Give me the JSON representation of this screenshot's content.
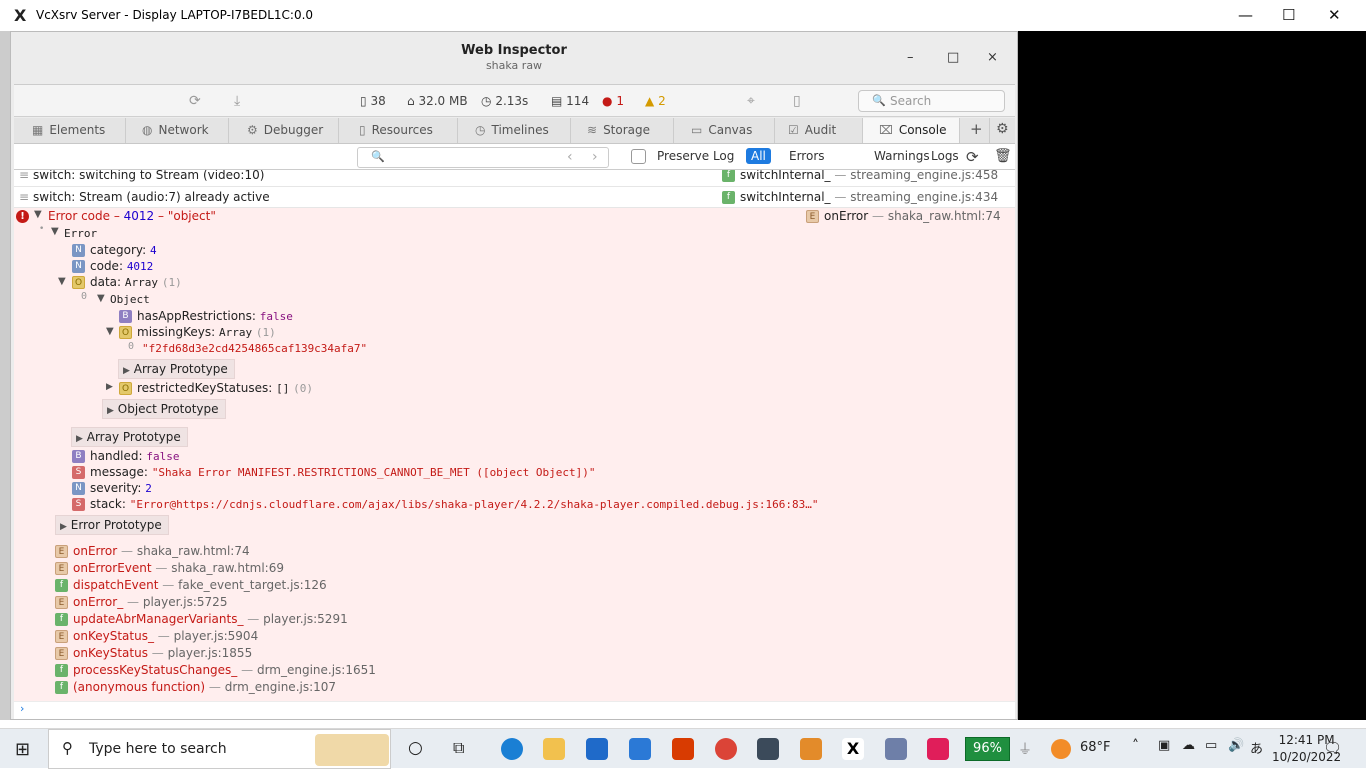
{
  "xwindow": {
    "title": "VcXsrv Server - Display LAPTOP-I7BEDL1C:0.0",
    "minimize": "—",
    "maximize": "☐",
    "close": "✕"
  },
  "inspector": {
    "title": "Web Inspector",
    "subtitle": "shaka raw",
    "minimize": "–",
    "maximize": "□",
    "close": "×",
    "toolbar": {
      "docs": "38",
      "memory": "32.0 MB",
      "time": "2.13s",
      "logs": "114",
      "errors": "1",
      "warnings": "2",
      "search_placeholder": "Search"
    },
    "tabs": [
      "Elements",
      "Network",
      "Debugger",
      "Resources",
      "Timelines",
      "Storage",
      "Canvas",
      "Audit",
      "Console"
    ],
    "filter": {
      "preserve": "Preserve Log",
      "all": "All",
      "errors": "Errors",
      "warnings": "Warnings",
      "logs": "Logs"
    },
    "console": {
      "msg1": {
        "text": "switch: switching to Stream (video:10)",
        "fn": "switchInternal_",
        "src": "streaming_engine.js:458"
      },
      "msg2": {
        "text": "switch: Stream (audio:7) already active",
        "fn": "switchInternal_",
        "src": "streaming_engine.js:434"
      },
      "error": {
        "prefix": "Error code – ",
        "code": "4012",
        "sep": " – ",
        "obj": "\"object\"",
        "fn": "onError",
        "src": "shaka_raw.html:74",
        "obj_name": "Error",
        "category_k": "category:",
        "category_v": "4",
        "code_k": "code:",
        "code_v": "4012",
        "data_k": "data:",
        "data_v": "Array",
        "data_c": "(1)",
        "idx0": "0",
        "object": "Object",
        "har_k": "hasAppRestrictions:",
        "har_v": "false",
        "mk_k": "missingKeys:",
        "mk_v": "Array",
        "mk_c": "(1)",
        "mk0_i": "0",
        "mk0_v": "\"f2fd68d3e2cd4254865caf139c34afa7\"",
        "array_proto": "Array Prototype",
        "rks_k": "restrictedKeyStatuses:",
        "rks_v": "[]",
        "rks_c": "(0)",
        "object_proto": "Object Prototype",
        "array_proto2": "Array Prototype",
        "handled_k": "handled:",
        "handled_v": "false",
        "message_k": "message:",
        "message_v": "\"Shaka Error MANIFEST.RESTRICTIONS_CANNOT_BE_MET ([object Object])\"",
        "severity_k": "severity:",
        "severity_v": "2",
        "stack_k": "stack:",
        "stack_v": "\"Error@https://cdnjs.cloudflare.com/ajax/libs/shaka-player/4.2.2/shaka-player.compiled.debug.js:166:83…\"",
        "error_proto": "Error Prototype"
      },
      "stack": [
        {
          "badge": "E",
          "fn": "onError",
          "src": "shaka_raw.html:74"
        },
        {
          "badge": "E",
          "fn": "onErrorEvent",
          "src": "shaka_raw.html:69"
        },
        {
          "badge": "f",
          "fn": "dispatchEvent",
          "src": "fake_event_target.js:126"
        },
        {
          "badge": "E",
          "fn": "onError_",
          "src": "player.js:5725"
        },
        {
          "badge": "f",
          "fn": "updateAbrManagerVariants_",
          "src": "player.js:5291"
        },
        {
          "badge": "E",
          "fn": "onKeyStatus_",
          "src": "player.js:5904"
        },
        {
          "badge": "E",
          "fn": "onKeyStatus",
          "src": "player.js:1855"
        },
        {
          "badge": "f",
          "fn": "processKeyStatusChanges_",
          "src": "drm_engine.js:1651"
        },
        {
          "badge": "f",
          "fn": "(anonymous function)",
          "src": "drm_engine.js:107"
        }
      ],
      "prompt": "›",
      "sep": " — "
    }
  },
  "taskbar": {
    "search": "Type here to search",
    "battery": "96%",
    "weather": "68°F",
    "time": "12:41 PM",
    "date": "10/20/2022"
  }
}
